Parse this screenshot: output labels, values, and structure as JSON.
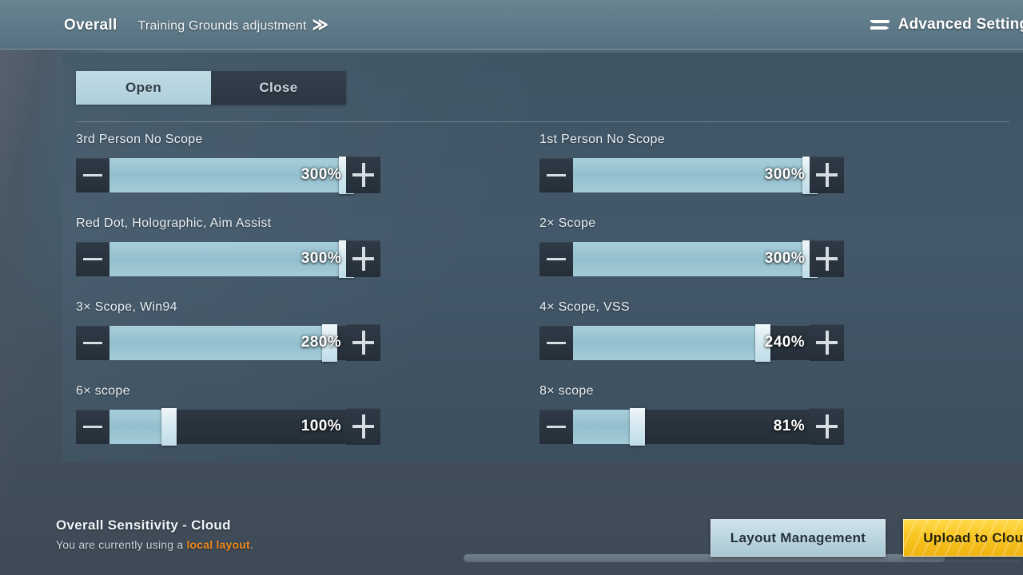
{
  "topbar": {
    "overall_label": "Overall",
    "training_label": "Training Grounds adjustment",
    "chevron": "≫",
    "advanced_label": "Advanced Settings",
    "swap_icon": "swap-arrows-icon"
  },
  "tabs": {
    "open_label": "Open",
    "close_label": "Close",
    "selected": "Open"
  },
  "sliders": [
    {
      "label": "3rd Person No Scope",
      "value": "300%",
      "percent": 100,
      "column": "left"
    },
    {
      "label": "1st Person No Scope",
      "value": "300%",
      "percent": 100,
      "column": "right"
    },
    {
      "label": "Red Dot, Holographic, Aim Assist",
      "value": "300%",
      "percent": 100,
      "column": "left"
    },
    {
      "label": "2× Scope",
      "value": "300%",
      "percent": 100,
      "column": "right"
    },
    {
      "label": "3× Scope, Win94",
      "value": "280%",
      "percent": 93,
      "column": "left"
    },
    {
      "label": "4× Scope, VSS",
      "value": "240%",
      "percent": 80,
      "column": "right"
    },
    {
      "label": "6× scope",
      "value": "100%",
      "percent": 25,
      "column": "left"
    },
    {
      "label": "8× scope",
      "value": "81%",
      "percent": 27,
      "column": "right"
    }
  ],
  "slider_buttons": {
    "decrease_label": "minus-icon",
    "increase_label": "plus-icon"
  },
  "footer": {
    "title": "Overall Sensitivity - Cloud",
    "status_prefix": "You are currently using a ",
    "status_highlight": "local layout",
    "status_suffix": ".",
    "highlight_color": "#f08a1e",
    "layout_management_label": "Layout Management",
    "upload_label": "Upload to Cloud"
  },
  "scrollbar": {
    "orientation": "horizontal",
    "thumb_percent": 86
  }
}
